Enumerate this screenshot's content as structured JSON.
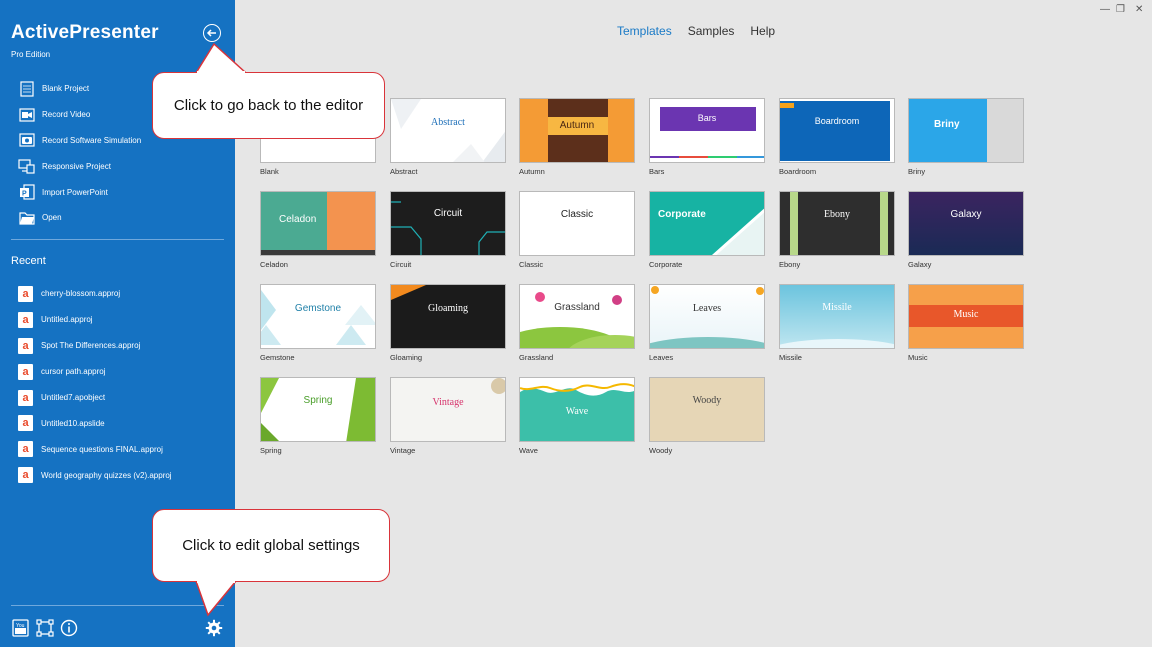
{
  "sidebar": {
    "app_title": "ActivePresenter",
    "edition": "Pro Edition",
    "actions": [
      {
        "label": "Blank Project",
        "icon": "blank-project-icon"
      },
      {
        "label": "Record Video",
        "icon": "record-video-icon"
      },
      {
        "label": "Record Software Simulation",
        "icon": "camera-icon"
      },
      {
        "label": "Responsive Project",
        "icon": "responsive-icon"
      },
      {
        "label": "Import PowerPoint",
        "icon": "powerpoint-icon"
      },
      {
        "label": "Open",
        "icon": "folder-open-icon"
      }
    ],
    "recent_title": "Recent",
    "recent": [
      "cherry-blossom.approj",
      "Untitled.approj",
      "Spot The Differences.approj",
      "cursor path.approj",
      "Untitled7.apobject",
      "Untitled10.apslide",
      "Sequence questions FINAL.approj",
      "World geography quizzes (v2).approj"
    ]
  },
  "nav": {
    "tabs": [
      "Templates",
      "Samples",
      "Help"
    ],
    "active": "Templates"
  },
  "templates": [
    {
      "name": "Blank",
      "thumb_text": ""
    },
    {
      "name": "Abstract",
      "thumb_text": "Abstract"
    },
    {
      "name": "Autumn",
      "thumb_text": "Autumn"
    },
    {
      "name": "Bars",
      "thumb_text": "Bars"
    },
    {
      "name": "Boardroom",
      "thumb_text": "Boardroom"
    },
    {
      "name": "Briny",
      "thumb_text": "Briny"
    },
    {
      "name": "Celadon",
      "thumb_text": "Celadon"
    },
    {
      "name": "Circuit",
      "thumb_text": "Circuit"
    },
    {
      "name": "Classic",
      "thumb_text": "Classic"
    },
    {
      "name": "Corporate",
      "thumb_text": "Corporate"
    },
    {
      "name": "Ebony",
      "thumb_text": "Ebony"
    },
    {
      "name": "Galaxy",
      "thumb_text": "Galaxy"
    },
    {
      "name": "Gemstone",
      "thumb_text": "Gemstone"
    },
    {
      "name": "Gloaming",
      "thumb_text": "Gloaming"
    },
    {
      "name": "Grassland",
      "thumb_text": "Grassland"
    },
    {
      "name": "Leaves",
      "thumb_text": "Leaves"
    },
    {
      "name": "Missile",
      "thumb_text": "Missile"
    },
    {
      "name": "Music",
      "thumb_text": "Music"
    },
    {
      "name": "Spring",
      "thumb_text": "Spring"
    },
    {
      "name": "Vintage",
      "thumb_text": "Vintage"
    },
    {
      "name": "Wave",
      "thumb_text": "Wave"
    },
    {
      "name": "Woody",
      "thumb_text": "Woody"
    }
  ],
  "callouts": {
    "back": "Click to go back to the editor",
    "settings": "Click to edit global settings"
  },
  "colors": {
    "sidebar": "#1572c2",
    "accent": "#1a7ac6",
    "callout_border": "#d9343a"
  }
}
